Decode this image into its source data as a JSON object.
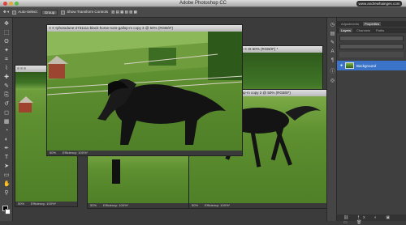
{
  "app": {
    "title": "Adobe Photoshop CC",
    "watermark": "www.andrewhainges.com"
  },
  "options_bar": {
    "auto_select_label": "Auto-Select:",
    "auto_select_value": "Group",
    "transform_controls_label": "Show Transform Controls"
  },
  "documents": [
    {
      "title": "photodune-2731111-black-horse-runs-gallop-m copy 3 @ 50% (RGB/8*)",
      "zoom": "50%",
      "efficiency": "Efficiency: 100%*"
    },
    {
      "title": "6 50% (RGB/8*) *",
      "zoom": "50%",
      "efficiency": "Efficiency: 100%*"
    },
    {
      "title": "1111-black-horse-runs-gallop-m copy 2 @ 50% (RGB/8*)",
      "zoom": "50%",
      "efficiency": "Efficiency: 100%*"
    },
    {
      "title": "",
      "zoom": "50%",
      "efficiency": "Efficiency: 100%*"
    },
    {
      "title": "",
      "zoom": "50%",
      "efficiency": "Efficiency: 100%*"
    }
  ],
  "panels": {
    "top_tabs": [
      "Adjustments",
      "Properties"
    ],
    "layer_tabs": [
      "Layers",
      "Channels",
      "Paths"
    ],
    "layer_name": "Background"
  },
  "colors": {
    "layer_highlight": "#3a73c8",
    "ui_dark": "#3b3b3b"
  },
  "icons": {
    "tools": [
      "move-icon",
      "marquee-icon",
      "lasso-icon",
      "quick-select-icon",
      "crop-icon",
      "eyedropper-icon",
      "healing-icon",
      "brush-icon",
      "stamp-icon",
      "history-brush-icon",
      "eraser-icon",
      "gradient-icon",
      "blur-icon",
      "dodge-icon",
      "pen-icon",
      "type-icon",
      "path-select-icon",
      "shape-icon",
      "hand-icon",
      "zoom-icon"
    ]
  }
}
